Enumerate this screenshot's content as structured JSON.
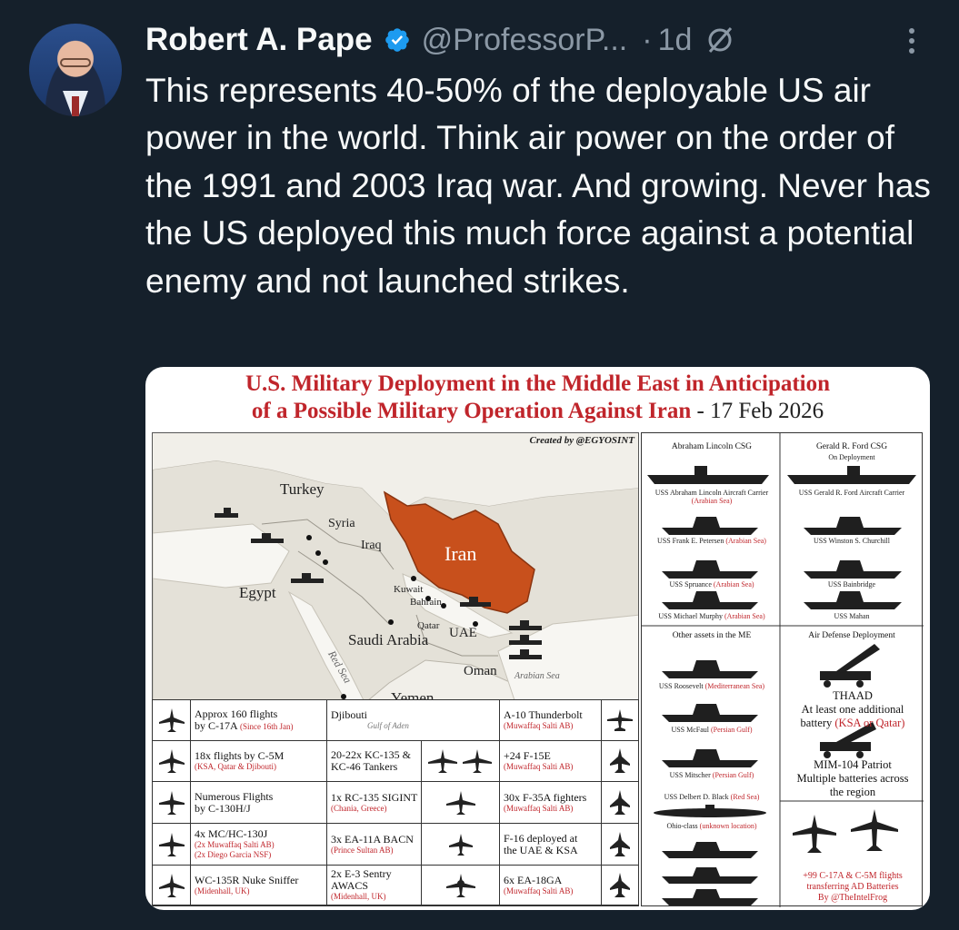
{
  "tweet": {
    "author_name": "Robert A. Pape",
    "handle": "@ProfessorP...",
    "separator": "·",
    "age": "1d",
    "text": "This represents 40-50% of the deployable US air power in the world.  Think air power on the order of the 1991 and 2003 Iraq war.  And growing.  Never has the US deployed this much force against a potential enemy and not launched strikes."
  },
  "colors": {
    "background": "#15202b",
    "text": "#f7f9f9",
    "muted": "#8b98a5",
    "verified_blue": "#1d9bf0",
    "iran_orange": "#c8501c",
    "accent_red": "#c0252b"
  },
  "image": {
    "title_line1": "U.S. Military Deployment in the Middle East in Anticipation",
    "title_line2": "of a Possible Military Operation Against Iran",
    "title_date": " - 17 Feb 2026",
    "credit": "Created by @EGYOSINT",
    "map_labels": {
      "turkey": "Turkey",
      "syria": "Syria",
      "iraq": "Iraq",
      "iran": "Iran",
      "egypt": "Egypt",
      "kuwait": "Kuwait",
      "bahrain": "Bahrain",
      "qatar": "Qatar",
      "uae": "UAE",
      "saudi": "Saudi Arabia",
      "oman": "Oman",
      "yemen": "Yemen",
      "djibouti": "Djibouti",
      "red_sea": "Red Sea",
      "arabian_sea": "Arabian Sea",
      "gulf_aden": "Gulf of Aden"
    },
    "left_table": [
      {
        "main": "Approx 160 flights",
        "main2": "by C-17A",
        "sub": "(Since 16th Jan)"
      },
      {
        "main": "18x flights by C-5M",
        "sub": "(KSA, Qatar & Djibouti)"
      },
      {
        "main": "Numerous Flights",
        "main2": "by C-130H/J"
      },
      {
        "main": "4x MC/HC-130J",
        "sub": "(2x Muwaffaq Salti AB)",
        "sub2": "(2x Diego Garcia NSF)"
      },
      {
        "main": "WC-135R Nuke Sniffer",
        "sub": "(Midenhall, UK)"
      }
    ],
    "mid_table": [
      {
        "main": "20-22x KC-135 &",
        "main2": "KC-46 Tankers"
      },
      {
        "main": "1x RC-135 SIGINT",
        "sub": "(Chania, Greece)"
      },
      {
        "main": "3x EA-11A BACN",
        "sub": "(Prince Sultan AB)"
      },
      {
        "main": "2x E-3 Sentry AWACS",
        "sub": "(Midenhall, UK)"
      }
    ],
    "right_table": [
      {
        "main": "A-10 Thunderbolt",
        "sub": "(Muwaffaq Salti AB)"
      },
      {
        "main": "+24 F-15E",
        "sub": "(Muwaffaq Salti AB)"
      },
      {
        "main": "30x F-35A fighters",
        "sub": "(Muwaffaq Salti AB)"
      },
      {
        "main": "F-16 deployed at",
        "main2": "the UAE & KSA"
      },
      {
        "main": "6x EA-18GA",
        "sub": "(Muwaffaq Salti AB)"
      }
    ],
    "panel": {
      "lincoln_head": "Abraham Lincoln CSG",
      "ford_head": "Gerald R. Ford CSG",
      "ford_status": "On Deployment",
      "lincoln_ships": [
        {
          "name": "USS Abraham Lincoln Aircraft Carrier",
          "loc": "(Arabian Sea)"
        },
        {
          "name": "USS Frank E. Petersen",
          "loc": "(Arabian Sea)"
        },
        {
          "name": "USS Spruance",
          "loc": "(Arabian Sea)"
        },
        {
          "name": "USS Michael Murphy",
          "loc": "(Arabian Sea)"
        }
      ],
      "ford_ships": [
        {
          "name": "USS Gerald R. Ford Aircraft Carrier"
        },
        {
          "name": "USS Winston S. Churchill"
        },
        {
          "name": "USS Bainbridge"
        },
        {
          "name": "USS Mahan"
        }
      ],
      "other_head": "Other assets in the ME",
      "other_ships": [
        {
          "name": "USS Roosevelt",
          "loc": "(Mediterranean Sea)"
        },
        {
          "name": "USS McFaul",
          "loc": "(Persian Gulf)"
        },
        {
          "name": "USS Mitscher",
          "loc": "(Persian Gulf)"
        },
        {
          "name": "USS Delbert D. Black",
          "loc": "(Red Sea)"
        },
        {
          "name": "Ohio-class",
          "loc": "(unknown location)"
        }
      ],
      "ad_head": "Air Defense Deployment",
      "thaad_title": "THAAD",
      "thaad_line1": "At least one additional",
      "thaad_line2": "battery",
      "thaad_loc": "(KSA or Qatar)",
      "patriot_title": "MIM-104 Patriot",
      "patriot_line1": "Multiple batteries across",
      "patriot_line2": "the region",
      "flights_line1": "+99 C-17A & C-5M flights",
      "flights_line2": "transferring AD Batteries",
      "flights_by": "By @TheIntelFrog"
    }
  }
}
